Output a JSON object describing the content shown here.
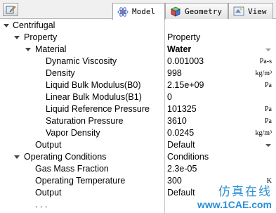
{
  "tabs": {
    "model": "Model",
    "geometry": "Geometry",
    "view": "View"
  },
  "tree": {
    "centrifugal": {
      "name": "Centrifugal",
      "value": ""
    },
    "property": {
      "name": "Property",
      "value": "Property"
    },
    "material": {
      "name": "Material",
      "value": "Water"
    },
    "dynamic_viscosity": {
      "name": "Dynamic Viscosity",
      "value": "0.001003",
      "unit": "Pa-s"
    },
    "density": {
      "name": "Density",
      "value": "998",
      "unit": "kg/m³"
    },
    "liquid_bulk_b0": {
      "name": "Liquid Bulk Modulus(B0)",
      "value": "2.15e+09",
      "unit": "Pa"
    },
    "linear_bulk_b1": {
      "name": "Linear Bulk Modulus(B1)",
      "value": "0"
    },
    "liquid_ref_pressure": {
      "name": "Liquid Reference Pressure",
      "value": "101325",
      "unit": "Pa"
    },
    "saturation_pressure": {
      "name": "Saturation Pressure",
      "value": "3610",
      "unit": "Pa"
    },
    "vapor_density": {
      "name": "Vapor Density",
      "value": "0.0245",
      "unit": "kg/m³"
    },
    "output1": {
      "name": "Output",
      "value": "Default"
    },
    "operating_conditions": {
      "name": "Operating Conditions",
      "value": "Conditions"
    },
    "gas_mass_fraction": {
      "name": "Gas Mass Fraction",
      "value": "2.3e-05"
    },
    "operating_temperature": {
      "name": "Operating Temperature",
      "value": "300",
      "unit": "K"
    },
    "output2": {
      "name": "Output",
      "value": "Default"
    },
    "more": {
      "name": ". . ."
    }
  },
  "watermark": {
    "cn": "仿真在线",
    "url": "www.1CAE.com"
  }
}
